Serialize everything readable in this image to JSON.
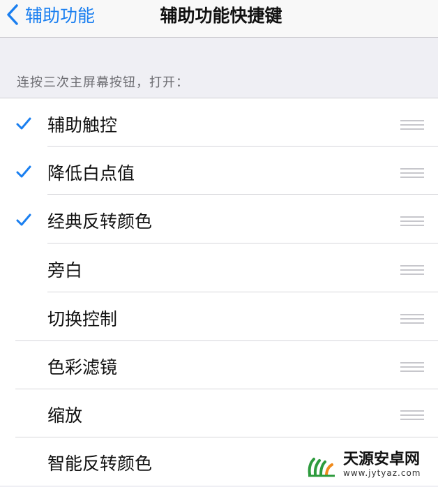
{
  "nav": {
    "back_label": "辅助功能",
    "title": "辅助功能快捷键"
  },
  "section_header": "连按三次主屏幕按钮，打开：",
  "items": [
    {
      "label": "辅助触控",
      "checked": true
    },
    {
      "label": "降低白点值",
      "checked": true
    },
    {
      "label": "经典反转颜色",
      "checked": true
    },
    {
      "label": "旁白",
      "checked": false
    },
    {
      "label": "切换控制",
      "checked": false
    },
    {
      "label": "色彩滤镜",
      "checked": false
    },
    {
      "label": "缩放",
      "checked": false
    },
    {
      "label": "智能反转颜色",
      "checked": false
    }
  ],
  "colors": {
    "accent": "#1a7ff0",
    "background": "#efeff4"
  },
  "watermark": {
    "title": "天源安卓网",
    "url": "www.jytyaz.com"
  }
}
